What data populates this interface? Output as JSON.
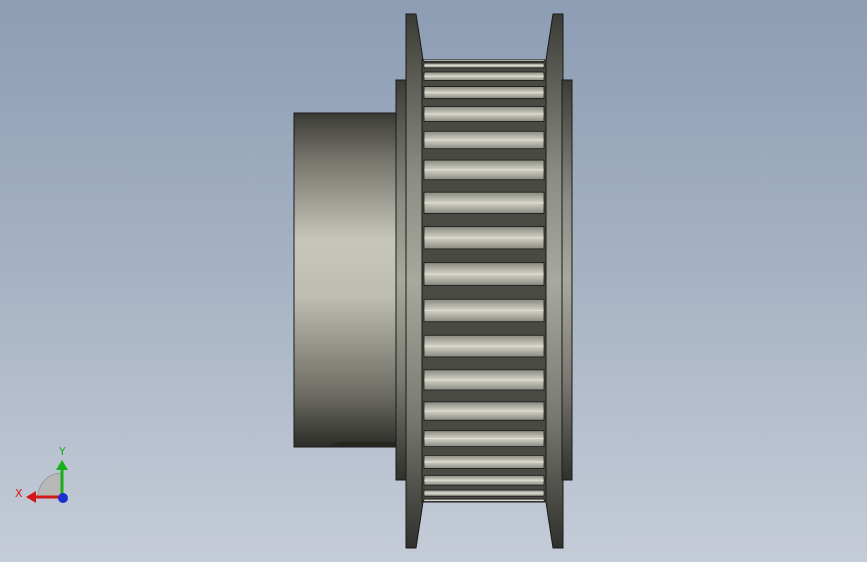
{
  "viewport": {
    "background_top": "#8d9db4",
    "background_bottom": "#c5ccd8"
  },
  "model": {
    "part": "timing-pulley",
    "view": "side",
    "tooth_count_visible": 19,
    "colors": {
      "metal_light": "#c9c9bd",
      "metal_mid": "#9c9c92",
      "metal_dark": "#2a2a26",
      "edge": "#1a1a18"
    }
  },
  "triad": {
    "x_label": "X",
    "y_label": "Y",
    "x_color": "#d01818",
    "y_color": "#18b018",
    "z_color": "#1830d0"
  }
}
